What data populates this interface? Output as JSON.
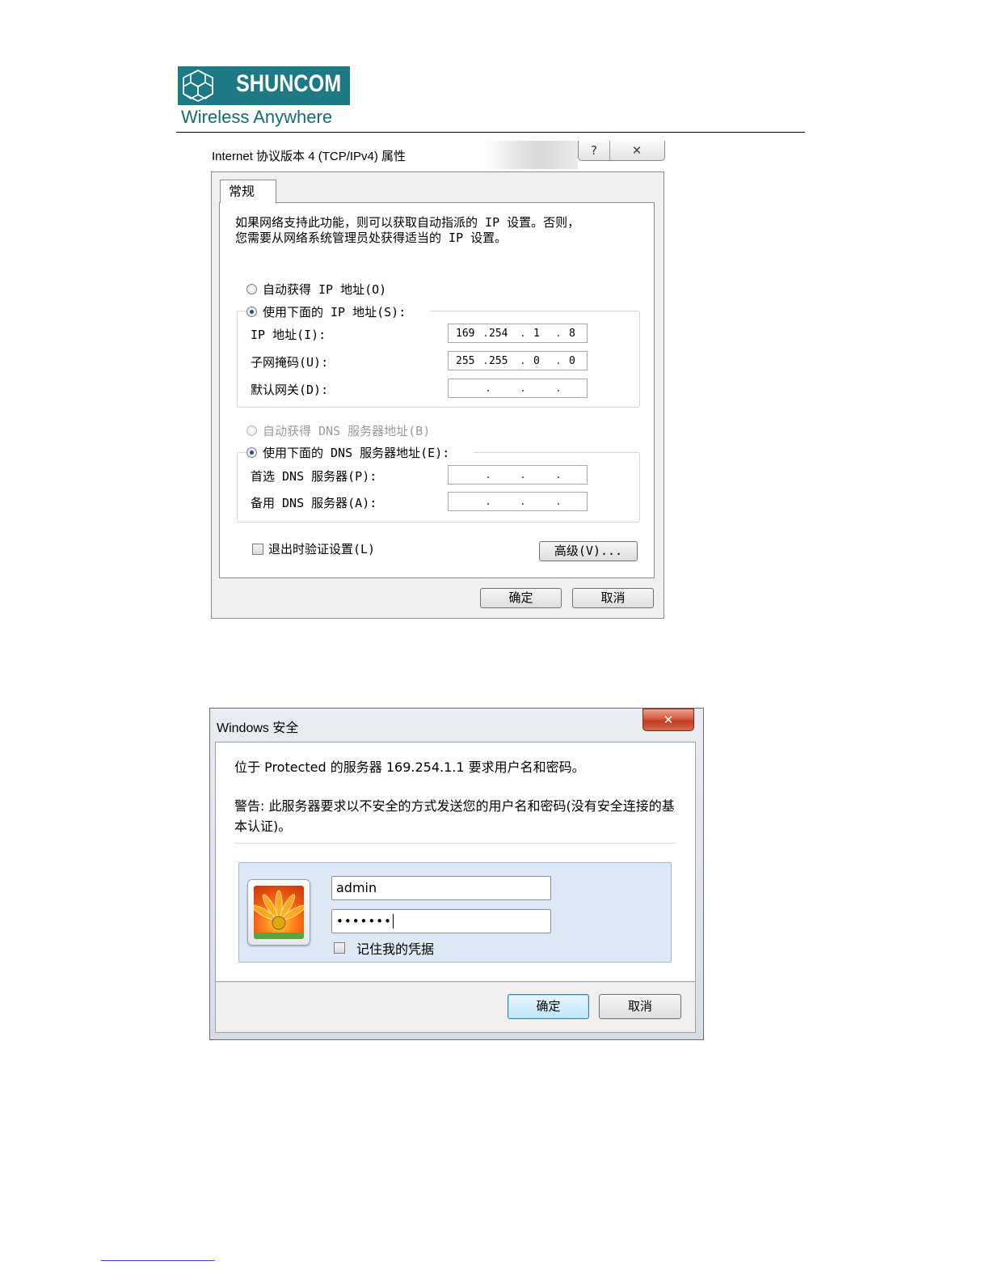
{
  "logo": {
    "brand": "SHUNCOM",
    "tagline": "Wireless Anywhere",
    "colors": {
      "box": "#1d7a84",
      "tagline": "#156b74"
    }
  },
  "tcp_dialog": {
    "title": "Internet 协议版本 4 (TCP/IPv4) 属性",
    "help_icon": "?",
    "close_icon": "✕",
    "tab_label": "常规",
    "description": [
      "如果网络支持此功能，则可以获取自动指派的 IP 设置。否则，",
      "您需要从网络系统管理员处获得适当的 IP 设置。"
    ],
    "radio_auto_ip": "自动获得 IP 地址(O)",
    "radio_manual_ip": "使用下面的 IP 地址(S):",
    "ip_label": "IP 地址(I):",
    "ip_value": [
      "169",
      "254",
      "1",
      "8"
    ],
    "subnet_label": "子网掩码(U):",
    "subnet_value": [
      "255",
      "255",
      "0",
      "0"
    ],
    "gateway_label": "默认网关(D):",
    "radio_auto_dns": "自动获得 DNS 服务器地址(B)",
    "radio_manual_dns": "使用下面的 DNS 服务器地址(E):",
    "preferred_dns_label": "首选 DNS 服务器(P):",
    "alternate_dns_label": "备用 DNS 服务器(A):",
    "validate_label": "退出时验证设置(L)",
    "advanced_button": "高级(V)...",
    "ok_button": "确定",
    "cancel_button": "取消"
  },
  "security_dialog": {
    "title": "Windows 安全",
    "close_icon": "✕",
    "message": "位于 Protected 的服务器 169.254.1.1 要求用户名和密码。",
    "warning": "警告: 此服务器要求以不安全的方式发送您的用户名和密码(没有安全连接的基本认证)。",
    "username": "admin",
    "password": "•••••••",
    "remember_label": "记住我的凭据",
    "ok_button": "确定",
    "cancel_button": "取消"
  }
}
